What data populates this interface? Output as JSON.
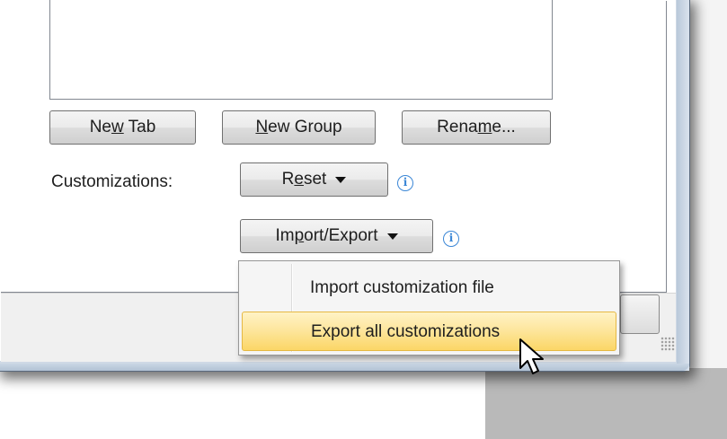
{
  "buttons": {
    "new_tab": {
      "pre": "Ne",
      "accel": "w",
      "post": " Tab"
    },
    "new_group": {
      "pre": "",
      "accel": "N",
      "post": "ew Group"
    },
    "rename": {
      "pre": "Rena",
      "accel": "m",
      "post": "e..."
    },
    "reset": {
      "pre": "R",
      "accel": "e",
      "post": "set"
    },
    "import_export": {
      "pre": "Im",
      "accel": "p",
      "post": "ort/Export"
    }
  },
  "customizations_label": "Customizations:",
  "info_icon_glyph": "i",
  "menu": {
    "items": [
      {
        "label": "Import customization file",
        "highlighted": false
      },
      {
        "label": "Export all customizations",
        "highlighted": true
      }
    ]
  },
  "colors": {
    "highlight": "#fde59a",
    "info_icon": "#3a86d6"
  }
}
